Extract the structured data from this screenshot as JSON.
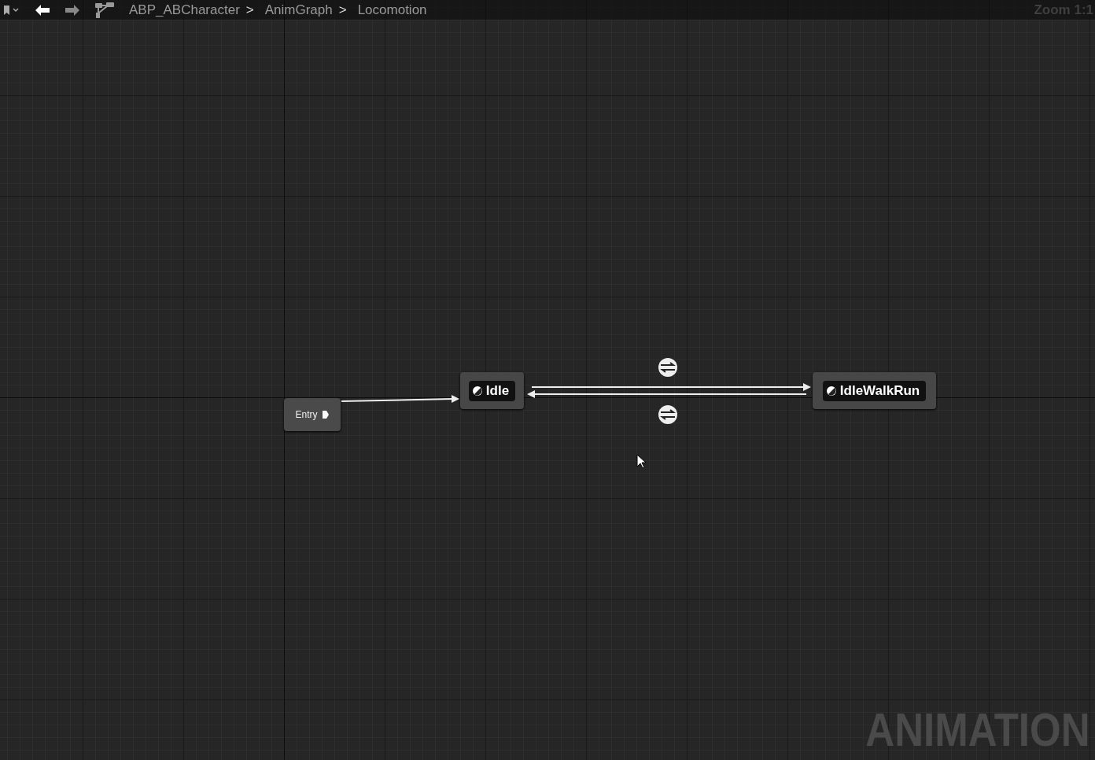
{
  "toolbar": {
    "breadcrumbs": [
      "ABP_ABCharacter",
      "AnimGraph",
      "Locomotion"
    ],
    "separators": [
      ">",
      ">"
    ]
  },
  "zoom_label": "Zoom 1:1",
  "nodes": [
    {
      "kind": "entry",
      "label": "Entry"
    },
    {
      "kind": "state",
      "label": "Idle"
    },
    {
      "kind": "state",
      "label": "IdleWalkRun"
    }
  ],
  "watermark": "ANIMATION"
}
